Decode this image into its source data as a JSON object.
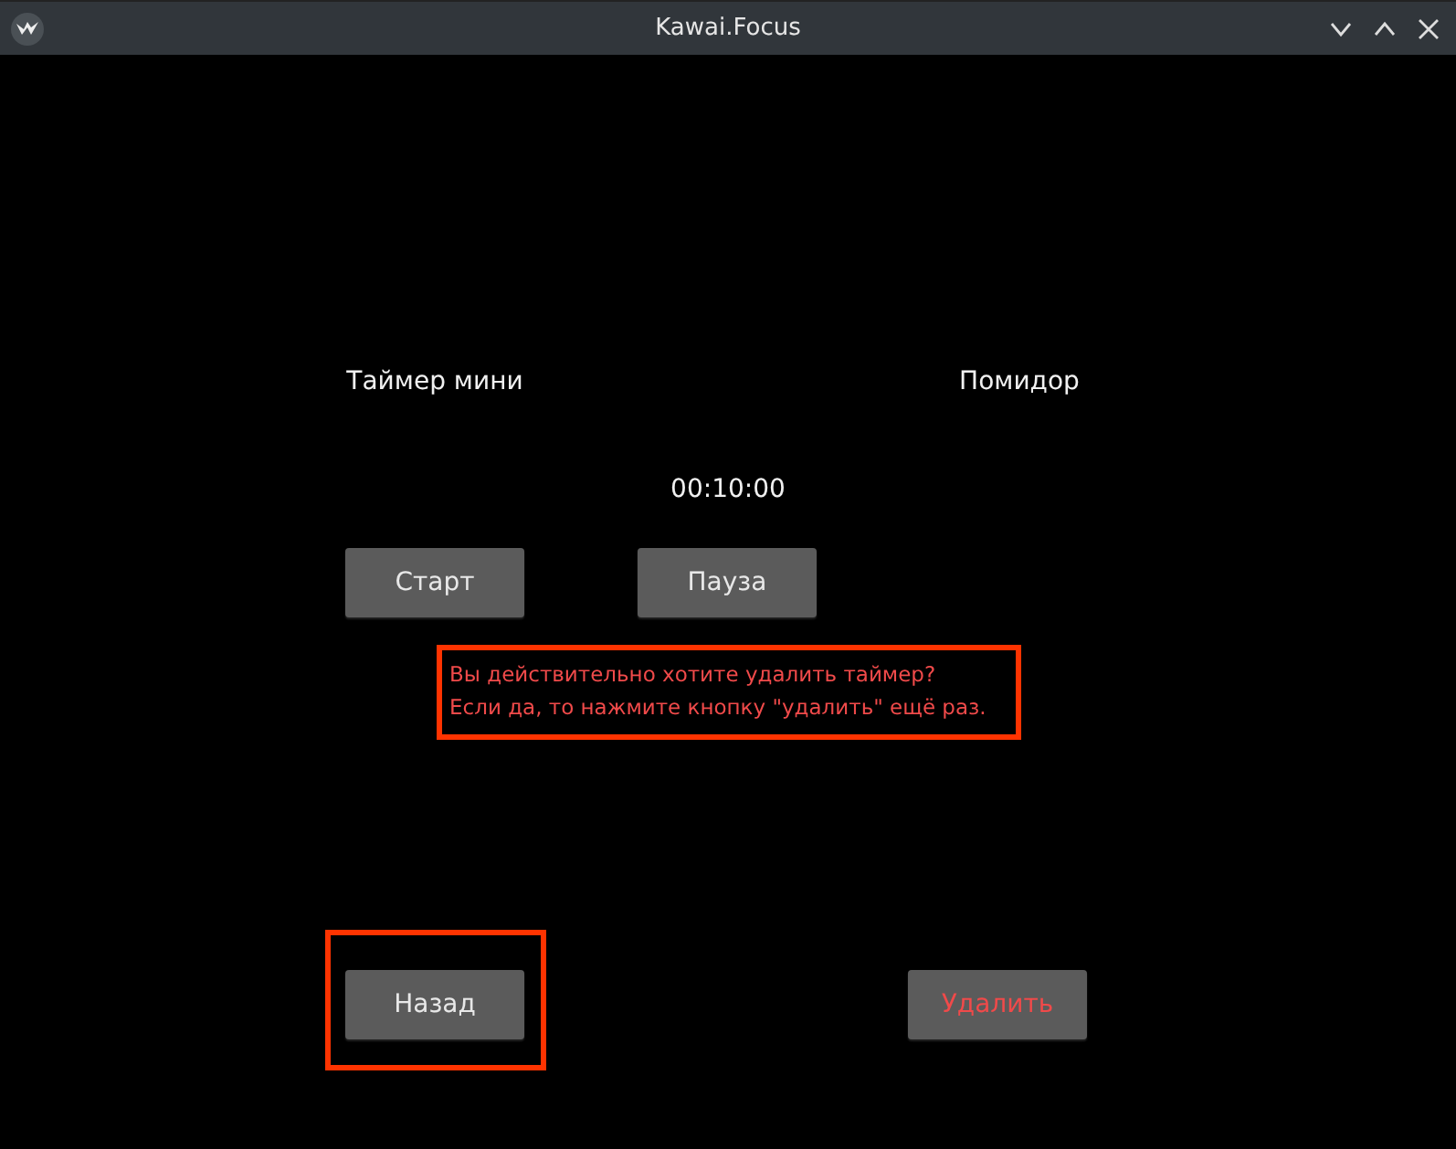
{
  "window": {
    "title": "Kawai.Focus"
  },
  "timer": {
    "name": "Таймер мини",
    "type": "Помидор",
    "time": "00:10:00"
  },
  "controls": [
    {
      "label": "Старт"
    },
    {
      "label": "Пауза"
    }
  ],
  "message": {
    "text": "Вы действительно хотите удалить таймер?\nЕсли да, то нажмите кнопку \"удалить\" ещё раз.",
    "highlighted": true
  },
  "actions": [
    {
      "label": "Назад",
      "kind": "normal",
      "highlighted": true
    },
    {
      "label": "Удалить",
      "kind": "danger",
      "highlighted": false
    }
  ]
}
